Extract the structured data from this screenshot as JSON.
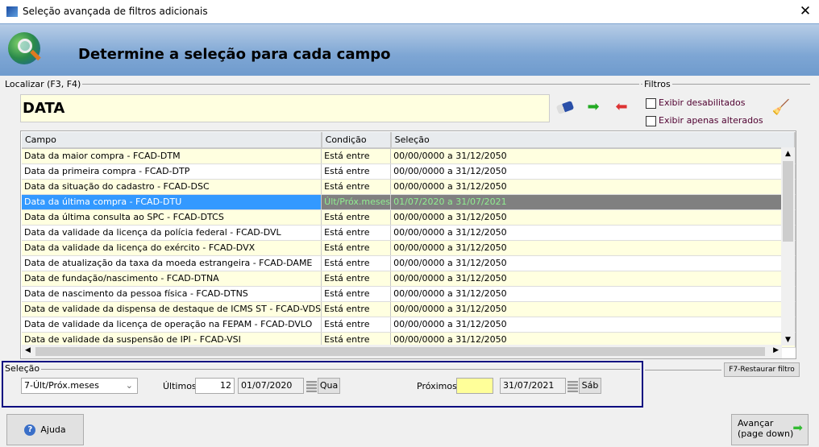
{
  "window": {
    "title": "Seleção avançada de filtros adicionais",
    "close": "✕"
  },
  "banner": {
    "heading": "Determine a seleção para cada campo"
  },
  "localizar": {
    "label": "Localizar (F3, F4)",
    "value": "DATA"
  },
  "filtros": {
    "label": "Filtros",
    "show_disabled": "Exibir desabilitados",
    "show_changed": "Exibir apenas alterados",
    "show_disabled_checked": false,
    "show_changed_checked": false
  },
  "grid": {
    "columns": [
      "Campo",
      "Condição",
      "Seleção"
    ],
    "rows": [
      [
        "Data da maior compra - FCAD-DTM",
        "Está entre",
        "00/00/0000 a 31/12/2050"
      ],
      [
        "Data da primeira compra - FCAD-DTP",
        "Está entre",
        "00/00/0000 a 31/12/2050"
      ],
      [
        "Data da situação do cadastro - FCAD-DSC",
        "Está entre",
        "00/00/0000 a 31/12/2050"
      ],
      [
        "Data da última compra - FCAD-DTU",
        "Últ/Próx.meses",
        "01/07/2020 a 31/07/2021"
      ],
      [
        "Data da última consulta ao SPC - FCAD-DTCS",
        "Está entre",
        "00/00/0000 a 31/12/2050"
      ],
      [
        "Data da validade da licença da polícia federal - FCAD-DVL",
        "Está entre",
        "00/00/0000 a 31/12/2050"
      ],
      [
        "Data da validade da licença do exército - FCAD-DVX",
        "Está entre",
        "00/00/0000 a 31/12/2050"
      ],
      [
        "Data de atualização da taxa da moeda estrangeira - FCAD-DAME",
        "Está entre",
        "00/00/0000 a 31/12/2050"
      ],
      [
        "Data de fundação/nascimento - FCAD-DTNA",
        "Está entre",
        "00/00/0000 a 31/12/2050"
      ],
      [
        "Data de nascimento da pessoa física - FCAD-DTNS",
        "Está entre",
        "00/00/0000 a 31/12/2050"
      ],
      [
        "Data de validade da dispensa de destaque de ICMS ST - FCAD-VDS",
        "Está entre",
        "00/00/0000 a 31/12/2050"
      ],
      [
        "Data de validade da licença de operação na FEPAM - FCAD-DVLO",
        "Está entre",
        "00/00/0000 a 31/12/2050"
      ],
      [
        "Data de validade da suspensão de IPI - FCAD-VSI",
        "Está entre",
        "00/00/0000 a 31/12/2050"
      ]
    ],
    "selected_row": 3
  },
  "selecao": {
    "label": "Seleção",
    "mode": "7-Últ/Próx.meses",
    "ultimos_label": "Últimos",
    "ultimos_value": "12",
    "start_date": "01/07/2020",
    "start_day": "Qua",
    "proximos_label": "Próximos",
    "proximos_value": "",
    "end_date": "31/07/2021",
    "end_day": "Sáb"
  },
  "buttons": {
    "restore": "F7-Restaurar filtro",
    "help": "Ajuda",
    "next_line1": "Avançar",
    "next_line2": "(page down)"
  },
  "colors": {
    "selection_border": "#0a0a80",
    "row_highlight": "#ffffe0",
    "selected_blue": "#3399ff"
  }
}
